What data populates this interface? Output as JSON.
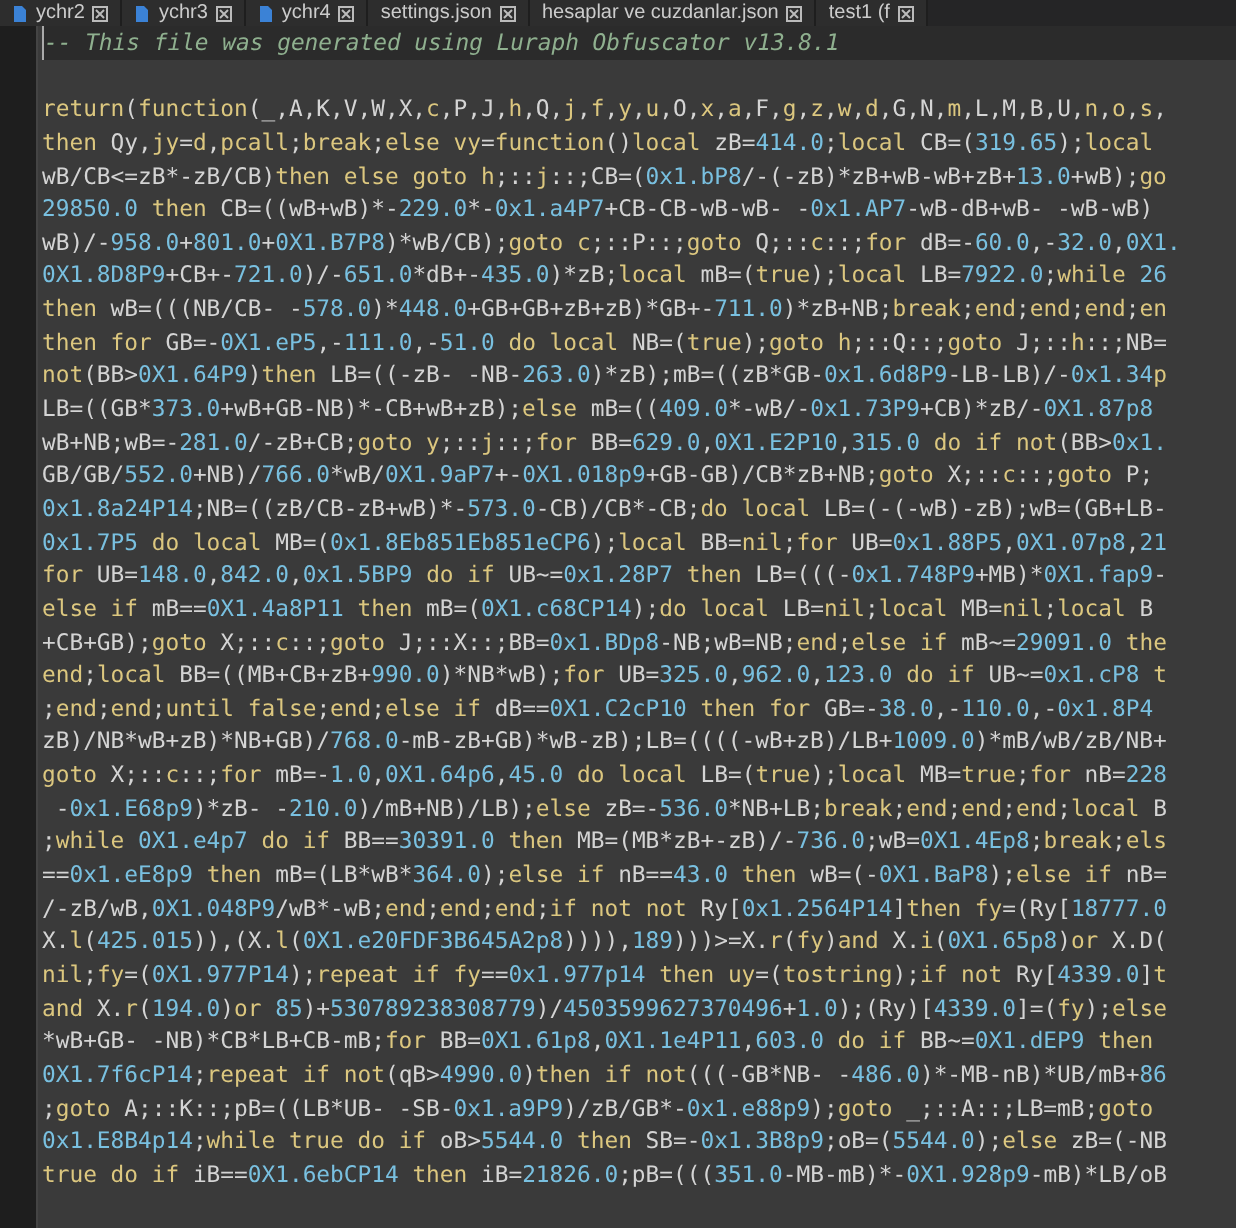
{
  "tabs": [
    {
      "label": "ychr2",
      "kind": "script",
      "selected": false
    },
    {
      "label": "ychr3",
      "kind": "script",
      "selected": false
    },
    {
      "label": "ychr4",
      "kind": "script",
      "selected": false
    },
    {
      "label": "settings.json",
      "kind": "json",
      "selected": false
    },
    {
      "label": "hesaplar ve cuzdanlar.json",
      "kind": "json",
      "selected": false
    },
    {
      "label": "test1 (f",
      "kind": "json",
      "selected": false
    }
  ],
  "editor": {
    "lines": [
      {
        "kind": "comment",
        "current": true,
        "text": "-- This file was generated using Luraph Obfuscator v13.8.1"
      },
      {
        "kind": "blank",
        "current": false
      },
      {
        "kind": "code",
        "current": false,
        "text": "return(function(_,A,K,V,W,X,c,P,J,h,Q,j,f,y,u,O,x,a,F,g,z,w,d,G,N,m,L,M,B,U,n,o,s,"
      },
      {
        "kind": "code",
        "current": false,
        "text": "then Qy,jy=d,pcall;break;else vy=function()local zB=414.0;local CB=(319.65);local"
      },
      {
        "kind": "code",
        "current": false,
        "text": "wB/CB<=zB*-zB/CB)then else goto h;::j::;CB=(0x1.bP8/-(-zB)*zB+wB-wB+zB+13.0+wB);go"
      },
      {
        "kind": "code",
        "current": false,
        "text": "29850.0 then CB=((wB+wB)*-229.0*-0x1.a4P7+CB-CB-wB-wB- -0x1.AP7-wB-dB+wB- -wB-wB)"
      },
      {
        "kind": "code",
        "current": false,
        "text": "wB)/-958.0+801.0+0X1.B7P8)*wB/CB);goto c;::P::;goto Q;::c::;for dB=-60.0,-32.0,0X1."
      },
      {
        "kind": "code",
        "current": false,
        "text": "0X1.8D8P9+CB+-721.0)/-651.0*dB+-435.0)*zB;local mB=(true);local LB=7922.0;while 26"
      },
      {
        "kind": "code",
        "current": false,
        "text": "then wB=(((NB/CB- -578.0)*448.0+GB+GB+zB+zB)*GB+-711.0)*zB+NB;break;end;end;end;en"
      },
      {
        "kind": "code",
        "current": false,
        "text": "then for GB=-0X1.eP5,-111.0,-51.0 do local NB=(true);goto h;::Q::;goto J;::h::;NB="
      },
      {
        "kind": "code",
        "current": false,
        "text": "not(BB>0X1.64P9)then LB=((-zB- -NB-263.0)*zB);mB=((zB*GB-0x1.6d8P9-LB-LB)/-0x1.34p"
      },
      {
        "kind": "code",
        "current": false,
        "text": "LB=((GB*373.0+wB+GB-NB)*-CB+wB+zB);else mB=((409.0*-wB/-0x1.73P9+CB)*zB/-0X1.87p8"
      },
      {
        "kind": "code",
        "current": false,
        "text": "wB+NB;wB=-281.0/-zB+CB;goto y;::j::;for BB=629.0,0X1.E2P10,315.0 do if not(BB>0x1."
      },
      {
        "kind": "code",
        "current": false,
        "text": "GB/GB/552.0+NB)/766.0*wB/0X1.9aP7+-0X1.018p9+GB-GB)/CB*zB+NB;goto X;::c::;goto P;"
      },
      {
        "kind": "code",
        "current": false,
        "text": "0x1.8a24P14;NB=((zB/CB-zB+wB)*-573.0-CB)/CB*-CB;do local LB=(-(-wB)-zB);wB=(GB+LB-"
      },
      {
        "kind": "code",
        "current": false,
        "text": "0x1.7P5 do local MB=(0x1.8Eb851Eb851eCP6);local BB=nil;for UB=0x1.88P5,0X1.07p8,21"
      },
      {
        "kind": "code",
        "current": false,
        "text": "for UB=148.0,842.0,0x1.5BP9 do if UB~=0x1.28P7 then LB=(((-0x1.748P9+MB)*0X1.fap9-"
      },
      {
        "kind": "code",
        "current": false,
        "text": "else if mB==0X1.4a8P11 then mB=(0X1.c68CP14);do local LB=nil;local MB=nil;local B"
      },
      {
        "kind": "code",
        "current": false,
        "text": "+CB+GB);goto X;::c::;goto J;::X::;BB=0x1.BDp8-NB;wB=NB;end;else if mB~=29091.0 the"
      },
      {
        "kind": "code",
        "current": false,
        "text": "end;local BB=((MB+CB+zB+990.0)*NB*wB);for UB=325.0,962.0,123.0 do if UB~=0x1.cP8 t"
      },
      {
        "kind": "code",
        "current": false,
        "text": ";end;end;until false;end;else if dB==0X1.C2cP10 then for GB=-38.0,-110.0,-0x1.8P4"
      },
      {
        "kind": "code",
        "current": false,
        "text": "zB)/NB*wB+zB)*NB+GB)/768.0-mB-zB+GB)*wB-zB);LB=((((-wB+zB)/LB+1009.0)*mB/wB/zB/NB+"
      },
      {
        "kind": "code",
        "current": false,
        "text": "goto X;::c::;for mB=-1.0,0X1.64p6,45.0 do local LB=(true);local MB=true;for nB=228"
      },
      {
        "kind": "code",
        "current": false,
        "text": " -0x1.E68p9)*zB- -210.0)/mB+NB)/LB);else zB=-536.0*NB+LB;break;end;end;end;local B"
      },
      {
        "kind": "code",
        "current": false,
        "text": ";while 0X1.e4p7 do if BB==30391.0 then MB=(MB*zB+-zB)/-736.0;wB=0X1.4Ep8;break;els"
      },
      {
        "kind": "code",
        "current": false,
        "text": "==0x1.eE8p9 then mB=(LB*wB*364.0);else if nB==43.0 then wB=(-0X1.BaP8);else if nB="
      },
      {
        "kind": "code",
        "current": false,
        "text": "/-zB/wB,0X1.048P9/wB*-wB;end;end;end;if not not Ry[0x1.2564P14]then fy=(Ry[18777.0"
      },
      {
        "kind": "code",
        "current": false,
        "text": "X.l(425.015)),(X.l(0X1.e20FDF3B645A2p8)))),189)))>=X.r(fy)and X.i(0X1.65p8)or X.D("
      },
      {
        "kind": "code",
        "current": false,
        "text": "nil;fy=(0X1.977P14);repeat if fy==0x1.977p14 then uy=(tostring);if not Ry[4339.0]t"
      },
      {
        "kind": "code",
        "current": false,
        "text": "and X.r(194.0)or 85)+530789238308779)/4503599627370496+1.0);(Ry)[4339.0]=(fy);else"
      },
      {
        "kind": "code",
        "current": false,
        "text": "*wB+GB- -NB)*CB*LB+CB-mB;for BB=0X1.61p8,0X1.1e4P11,603.0 do if BB~=0X1.dEP9 then"
      },
      {
        "kind": "code",
        "current": false,
        "text": "0X1.7f6cP14;repeat if not(qB>4990.0)then if not(((-GB*NB- -486.0)*-MB-nB)*UB/mB+86"
      },
      {
        "kind": "code",
        "current": false,
        "text": ";goto A;::K::;pB=((LB*UB- -SB-0x1.a9P9)/zB/GB*-0x1.e88p9);goto _;::A::;LB=mB;goto"
      },
      {
        "kind": "code",
        "current": false,
        "text": "0x1.E8B4p14;while true do if oB>5544.0 then SB=-0x1.3B8p9;oB=(5544.0);else zB=(-NB"
      },
      {
        "kind": "code",
        "current": false,
        "text": "true do if iB==0X1.6ebCP14 then iB=21826.0;pB=(((351.0-MB-mB)*-0X1.928p9-mB)*LB/oB"
      }
    ]
  }
}
